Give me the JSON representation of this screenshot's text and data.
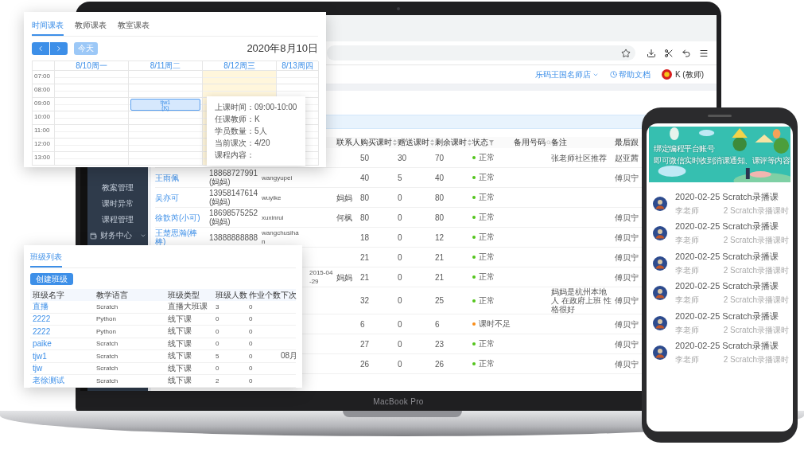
{
  "laptop": {
    "label": "MacBook Pro",
    "header": {
      "shop": "乐码王国名师店",
      "help": "帮助文档",
      "user": "K (教师)"
    },
    "sidebar": {
      "items": [
        {
          "label": "教案管理",
          "kind": "link"
        },
        {
          "label": "课时异常",
          "kind": "link"
        },
        {
          "label": "课程管理",
          "kind": "link"
        },
        {
          "label": "财务中心",
          "kind": "group"
        }
      ]
    },
    "students": {
      "columns": [
        {
          "label": "联系人",
          "kind": "plain"
        },
        {
          "label": "购买课时",
          "kind": "sortable"
        },
        {
          "label": "赠送课时",
          "kind": "sortable"
        },
        {
          "label": "剩余课时",
          "kind": "sortable"
        },
        {
          "label": "状态",
          "kind": "filterable"
        },
        {
          "label": "备用号码",
          "kind": "searchable"
        },
        {
          "label": "备注",
          "kind": "plain"
        },
        {
          "label": "最后跟",
          "kind": "plain"
        }
      ],
      "rows": [
        {
          "bought": "50",
          "gift": "30",
          "remain": "70",
          "status": {
            "text": "正常",
            "color": "#52c41a"
          },
          "remark": "张老师社区推荐",
          "follower": "赵亚茜"
        },
        {
          "name": "王雨佩",
          "phone": "18868727991(妈妈)",
          "account": "wangyupei",
          "bought": "40",
          "gift": "5",
          "remain": "40",
          "status": {
            "text": "正常",
            "color": "#52c41a"
          },
          "follower": "傅贝宁"
        },
        {
          "name": "吴亦可",
          "phone": "13958147614(妈妈)",
          "account": "wuyike",
          "contact": "妈妈",
          "bought": "80",
          "gift": "0",
          "remain": "80",
          "status": {
            "text": "正常",
            "color": "#52c41a"
          }
        },
        {
          "name": "徐歆芮(小可)",
          "phone": "18698575252(妈妈)",
          "account": "xuxinrui",
          "contact": "何枫",
          "bought": "80",
          "gift": "0",
          "remain": "80",
          "status": {
            "text": "正常",
            "color": "#52c41a"
          },
          "follower": "傅贝宁"
        },
        {
          "name": "王楚思瀚(棒棒)",
          "phone": "13888888888",
          "account": "wangchusihan",
          "bought": "18",
          "gift": "0",
          "remain": "12",
          "status": {
            "text": "正常",
            "color": "#52c41a"
          },
          "follower": "傅贝宁"
        },
        {
          "bought": "21",
          "gift": "0",
          "remain": "21",
          "status": {
            "text": "正常",
            "color": "#52c41a"
          },
          "follower": "傅贝宁"
        },
        {
          "date": "2015-04-29",
          "contact": "妈妈",
          "bought": "21",
          "gift": "0",
          "remain": "21",
          "status": {
            "text": "正常",
            "color": "#52c41a"
          },
          "follower": "傅贝宁"
        },
        {
          "bought": "32",
          "gift": "0",
          "remain": "25",
          "status": {
            "text": "正常",
            "color": "#52c41a"
          },
          "remark": "妈妈是杭州本地人 在政府上班 性格很好",
          "follower": "傅贝宁"
        },
        {
          "bought": "6",
          "gift": "0",
          "remain": "6",
          "status": {
            "text": "课时不足",
            "color": "#fa8c16"
          },
          "follower": "傅贝宁"
        },
        {
          "bought": "27",
          "gift": "0",
          "remain": "23",
          "status": {
            "text": "正常",
            "color": "#52c41a"
          },
          "follower": "傅贝宁"
        },
        {
          "bought": "26",
          "gift": "0",
          "remain": "26",
          "status": {
            "text": "正常",
            "color": "#52c41a"
          },
          "follower": "傅贝宁"
        }
      ]
    }
  },
  "calendar": {
    "tabs": [
      {
        "label": "时间课表",
        "selected": true
      },
      {
        "label": "教师课表",
        "selected": false
      },
      {
        "label": "教室课表",
        "selected": false
      }
    ],
    "today_button": {
      "label": "今天",
      "disabled": true
    },
    "title": "2020年8月10日",
    "days": [
      {
        "label": "8/10周一",
        "today": false
      },
      {
        "label": "8/11周二",
        "today": false
      },
      {
        "label": "8/12周三",
        "today": true
      },
      {
        "label": "8/13周四",
        "today": false
      }
    ],
    "rows": [
      {
        "time": "07:00"
      },
      {
        "time": "08:00"
      },
      {
        "time": "09:00",
        "cells": [
          {
            "kind": "empty"
          },
          {
            "kind": "event",
            "title": "tjw1",
            "teacher": "(K)",
            "popover": [
              "上课时间：09:00-10:00",
              "任课教师：K",
              "学员数量：5人",
              "当前课次：4/20",
              "课程内容："
            ]
          },
          {
            "kind": "empty"
          },
          {
            "kind": "empty"
          }
        ]
      },
      {
        "time": "10:00"
      },
      {
        "time": "11:00"
      },
      {
        "time": "12:00"
      },
      {
        "time": "13:00"
      }
    ]
  },
  "class_list": {
    "tabs": [
      {
        "label": "班级列表",
        "selected": true
      }
    ],
    "create_button": "创建班级",
    "columns": [
      "班级名字",
      "教学语言",
      "班级类型",
      "班级人数",
      "作业个数",
      "下次"
    ],
    "rows": [
      {
        "cells": [
          "直播",
          "Scratch",
          "直播大班课",
          "3",
          "0"
        ]
      },
      {
        "cells": [
          "2222",
          "Python",
          "线下课",
          "0",
          "0"
        ]
      },
      {
        "cells": [
          "2222",
          "Python",
          "线下课",
          "0",
          "0"
        ]
      },
      {
        "cells": [
          "paike",
          "Scratch",
          "线下课",
          "0",
          "0"
        ]
      },
      {
        "cells": [
          "tjw1",
          "Scratch",
          "线下课",
          "5",
          "0",
          "08月"
        ]
      },
      {
        "cells": [
          "tjw",
          "Scratch",
          "线下课",
          "0",
          "0"
        ]
      },
      {
        "cells": [
          "老徐测试",
          "Scratch",
          "线下课",
          "2",
          "0"
        ]
      }
    ]
  },
  "phone": {
    "banner": {
      "kind": "picture",
      "lines": [
        "绑定编程平台账号",
        "即可微信实时收到消课通知、课评等内容"
      ]
    },
    "lessons": [
      {
        "title": "2020-02-25 Scratch录播课",
        "teacher": "李老师",
        "hours": "2 Scratch录播课时"
      },
      {
        "title": "2020-02-25 Scratch录播课",
        "teacher": "李老师",
        "hours": "2 Scratch录播课时"
      },
      {
        "title": "2020-02-25 Scratch录播课",
        "teacher": "李老师",
        "hours": "2 Scratch录播课时"
      },
      {
        "title": "2020-02-25 Scratch录播课",
        "teacher": "李老师",
        "hours": "2 Scratch录播课时"
      },
      {
        "title": "2020-02-25 Scratch录播课",
        "teacher": "李老师",
        "hours": "2 Scratch录播课时"
      },
      {
        "title": "2020-02-25 Scratch录播课",
        "teacher": "李老师",
        "hours": "2 Scratch录播课时"
      }
    ]
  }
}
